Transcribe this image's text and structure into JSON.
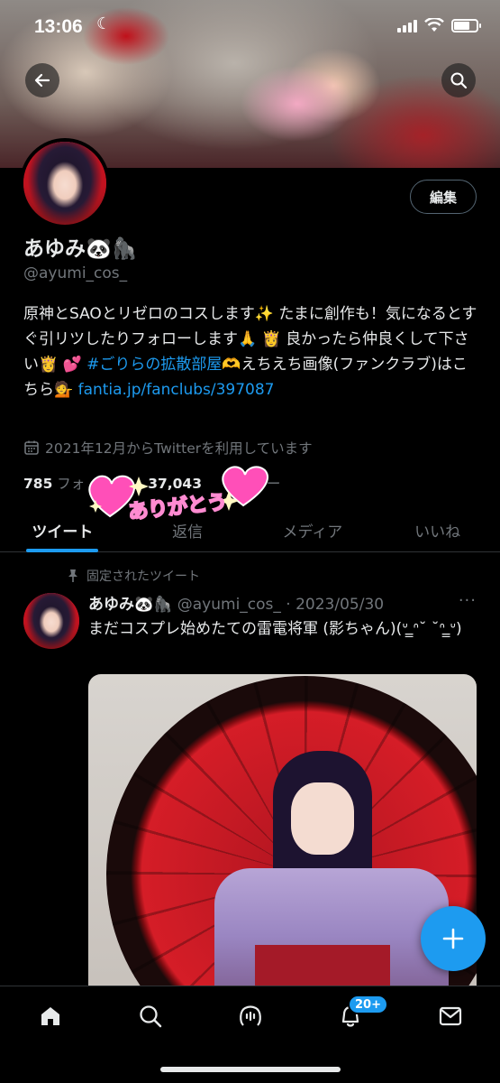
{
  "status_bar": {
    "time": "13:06"
  },
  "profile": {
    "name": "あゆみ🐼🦍",
    "handle": "@ayumi_cos_",
    "edit_label": "編集",
    "bio_text": "原神とSAOとリゼロのコスします✨ たまに創作も！気になるとすぐ引リツしたりフォローします🙏 👸 良かったら仲良くして下さい👸 💕 ",
    "bio_hashtag": "#ごりらの拡散部屋",
    "bio_after_hashtag": "🫶えちえち画像(ファンクラブ)はこちら💁 ",
    "bio_link": "fantia.jp/fanclubs/397087",
    "joined": "2021年12月からTwitterを利用しています",
    "following_count": "785",
    "following_label": "フォ",
    "followers_count": "37,043",
    "followers_label": "ー"
  },
  "sticker_text": "ありがとう",
  "tabs": [
    {
      "label": "ツイート",
      "active": true
    },
    {
      "label": "返信",
      "active": false
    },
    {
      "label": "メディア",
      "active": false
    },
    {
      "label": "いいね",
      "active": false
    }
  ],
  "pinned_tweet": {
    "pinned_label": "固定されたツイート",
    "author_name": "あゆみ🐼🦍",
    "author_handle": "@ayumi_cos_",
    "date": "· 2023/05/30",
    "more": "···",
    "text": "まだコスプレ始めたての雷電将軍 (影ちゃん)(ᐡ ̳ᐢ˘ ˘ᐢ ̳ᐡ)"
  },
  "bottom_nav": {
    "notifications_badge": "20+",
    "items": [
      "home-icon",
      "search-icon",
      "spaces-icon",
      "notifications-icon",
      "messages-icon"
    ]
  },
  "colors": {
    "accent": "#1d9bf0",
    "background": "#000000",
    "muted": "#71767b"
  }
}
